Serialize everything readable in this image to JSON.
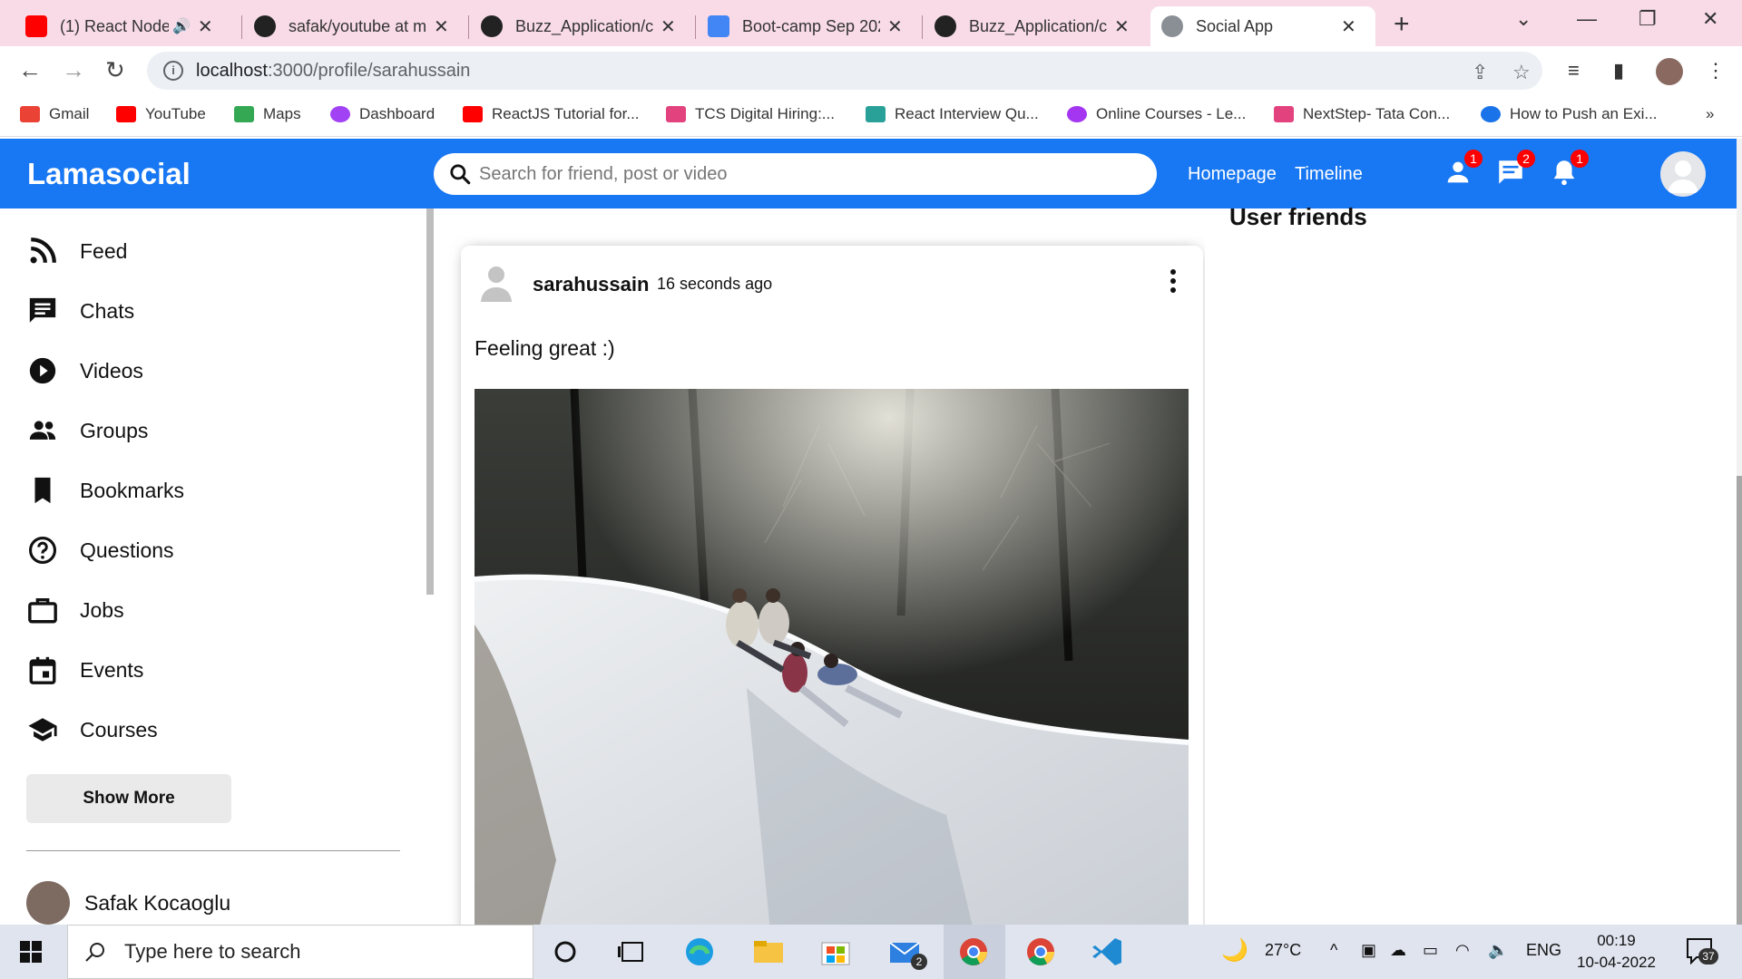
{
  "browser": {
    "tabs": [
      {
        "label": "(1) React Node...",
        "icon": "youtube-icon",
        "color": "#ff0000",
        "active": false
      },
      {
        "label": "safak/youtube at m",
        "icon": "github-icon",
        "color": "#222222",
        "active": false
      },
      {
        "label": "Buzz_Application/cl",
        "icon": "github-icon",
        "color": "#222222",
        "active": false
      },
      {
        "label": "Boot-camp Sep 202",
        "icon": "google-docs-icon",
        "color": "#4285f4",
        "active": false
      },
      {
        "label": "Buzz_Application/cl",
        "icon": "github-icon",
        "color": "#222222",
        "active": false
      },
      {
        "label": "Social App",
        "icon": "globe-icon",
        "color": "#5f6368",
        "active": true
      }
    ],
    "url_host": "localhost",
    "url_path": ":3000/profile/sarahussain",
    "bookmarks": [
      {
        "label": "Gmail",
        "icon": "gmail-icon",
        "color": "#ea4335"
      },
      {
        "label": "YouTube",
        "icon": "youtube-icon",
        "color": "#ff0000"
      },
      {
        "label": "Maps",
        "icon": "maps-icon",
        "color": "#34a853"
      },
      {
        "label": "Dashboard",
        "icon": "dashboard-icon",
        "color": "#a142f4"
      },
      {
        "label": "ReactJS Tutorial for...",
        "icon": "youtube-icon",
        "color": "#ff0000"
      },
      {
        "label": "TCS Digital Hiring:...",
        "icon": "tcs-icon",
        "color": "#e2427d"
      },
      {
        "label": "React Interview Qu...",
        "icon": "site-icon",
        "color": "#2aa198"
      },
      {
        "label": "Online Courses - Le...",
        "icon": "udemy-icon",
        "color": "#a435f0"
      },
      {
        "label": "NextStep- Tata Con...",
        "icon": "tcs-icon",
        "color": "#e2427d"
      },
      {
        "label": "How to Push an Exi...",
        "icon": "site-icon",
        "color": "#1a73e8"
      }
    ]
  },
  "app": {
    "logo": "Lamasocial",
    "brand_color": "#1877f2",
    "search_placeholder": "Search for friend, post or video",
    "links": {
      "homepage": "Homepage",
      "timeline": "Timeline"
    },
    "badges": {
      "friends": "1",
      "messages": "2",
      "notifications": "1"
    }
  },
  "sidebar": {
    "items": [
      {
        "label": "Feed",
        "icon": "rss-feed-icon"
      },
      {
        "label": "Chats",
        "icon": "chat-icon"
      },
      {
        "label": "Videos",
        "icon": "play-circle-icon"
      },
      {
        "label": "Groups",
        "icon": "group-icon"
      },
      {
        "label": "Bookmarks",
        "icon": "bookmark-icon"
      },
      {
        "label": "Questions",
        "icon": "help-circle-icon"
      },
      {
        "label": "Jobs",
        "icon": "briefcase-icon"
      },
      {
        "label": "Events",
        "icon": "calendar-icon"
      },
      {
        "label": "Courses",
        "icon": "school-icon"
      }
    ],
    "show_more": "Show More",
    "friends": [
      {
        "name": "Safak Kocaoglu"
      }
    ]
  },
  "post": {
    "username": "sarahussain",
    "time": "16 seconds ago",
    "text": "Feeling great :)"
  },
  "rightbar": {
    "title": "User friends"
  },
  "taskbar": {
    "search_placeholder": "Type here to search",
    "weather": "27°C",
    "language": "ENG",
    "time": "00:19",
    "date": "10-04-2022",
    "notification_count": "37",
    "mail_badge": "2"
  }
}
